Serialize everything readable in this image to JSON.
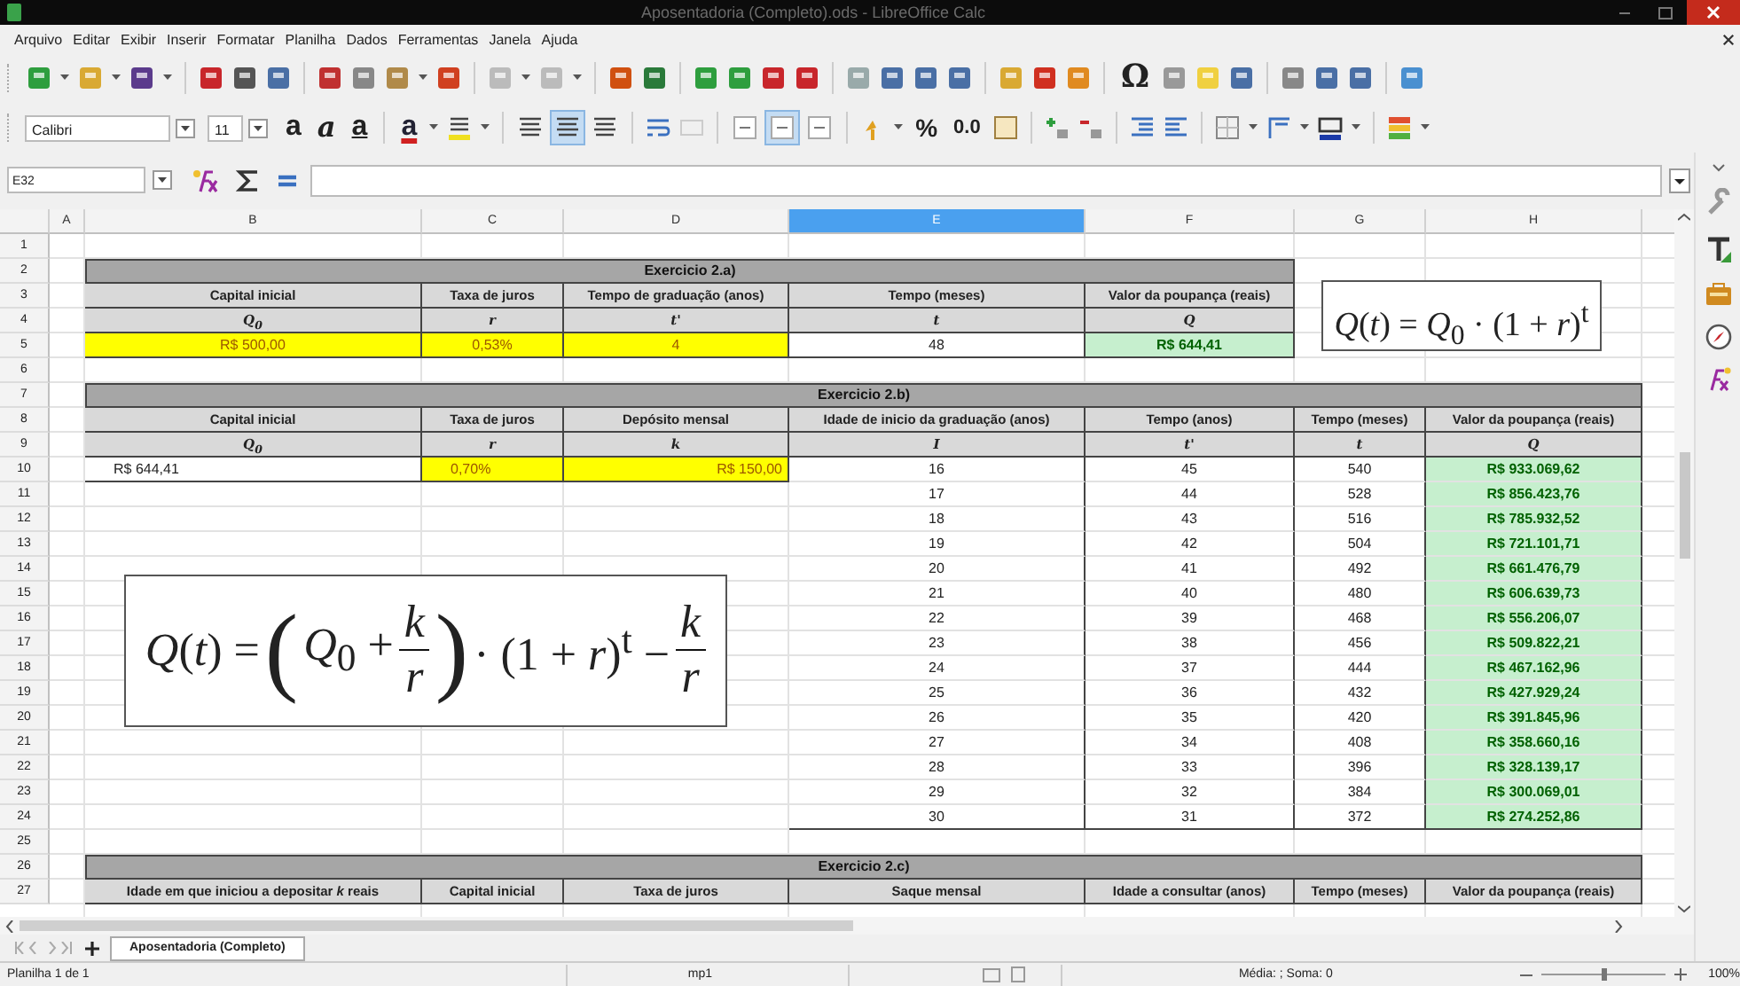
{
  "window": {
    "title": "Aposentadoria (Completo).ods - LibreOffice Calc"
  },
  "menu": [
    "Arquivo",
    "Editar",
    "Exibir",
    "Inserir",
    "Formatar",
    "Planilha",
    "Dados",
    "Ferramentas",
    "Janela",
    "Ajuda"
  ],
  "toolbar": {
    "special_character": "Ω"
  },
  "format_toolbar": {
    "font_name": "Calibri",
    "font_size": "11",
    "bold": "a",
    "italic": "a",
    "underline": "a",
    "font_color": "a",
    "percent": "%",
    "number": "0.0",
    "horizontal_align": [
      {
        "selected": false
      },
      {
        "selected": true
      },
      {
        "selected": false
      }
    ],
    "vertical_align": [
      {
        "selected": false
      },
      {
        "selected": true
      },
      {
        "selected": false
      }
    ]
  },
  "formula_bar": {
    "name_box": "E32"
  },
  "columns": [
    {
      "label": "A",
      "selected": false
    },
    {
      "label": "B",
      "selected": false
    },
    {
      "label": "C",
      "selected": false
    },
    {
      "label": "D",
      "selected": false
    },
    {
      "label": "E",
      "selected": true
    },
    {
      "label": "F",
      "selected": false
    },
    {
      "label": "G",
      "selected": false
    },
    {
      "label": "H",
      "selected": false
    }
  ],
  "row_numbers": [
    "1",
    "2",
    "3",
    "4",
    "5",
    "6",
    "7",
    "8",
    "9",
    "10",
    "11",
    "12",
    "13",
    "14",
    "15",
    "16",
    "17",
    "18",
    "19",
    "20",
    "21",
    "22",
    "23",
    "24",
    "25",
    "26",
    "27"
  ],
  "exercise_a": {
    "title": "Exercicio 2.a)",
    "headers": [
      "Capital inicial",
      "Taxa de juros",
      "Tempo de graduação (anos)",
      "Tempo (meses)",
      "Valor da poupança (reais)"
    ],
    "symbols": [
      "Q$_{0}$",
      "r",
      "t'",
      "t",
      "Q"
    ],
    "values": [
      {
        "text": "R$ 500,00",
        "kind": "input"
      },
      {
        "text": "0,53%",
        "kind": "input"
      },
      {
        "text": "4",
        "kind": "input"
      },
      {
        "text": "48",
        "kind": "plain"
      },
      {
        "text": "R$ 644,41",
        "kind": "result"
      }
    ]
  },
  "formula_a": "*Q*(*t*) = *Q*$_{0}$ · (1 + *r*)$^{t}$",
  "exercise_b": {
    "title": "Exercicio 2.b)",
    "headers": [
      "Capital inicial",
      "Taxa de juros",
      "Depósito mensal",
      "Idade de inicio da graduação (anos)",
      "Tempo (anos)",
      "Tempo (meses)",
      "Valor da poupança (reais)"
    ],
    "symbols": [
      "Q$_{0}$",
      "r",
      "k",
      "I",
      "t'",
      "t",
      "Q"
    ],
    "inputs": [
      {
        "text": "R$ 644,41",
        "kind": "plain"
      },
      {
        "text": "0,70%",
        "kind": "input"
      },
      {
        "text": "R$ 150,00",
        "kind": "input"
      }
    ],
    "rows": [
      {
        "age": "16",
        "years": "45",
        "months": "540",
        "value": "R$ 933.069,62"
      },
      {
        "age": "17",
        "years": "44",
        "months": "528",
        "value": "R$ 856.423,76"
      },
      {
        "age": "18",
        "years": "43",
        "months": "516",
        "value": "R$ 785.932,52"
      },
      {
        "age": "19",
        "years": "42",
        "months": "504",
        "value": "R$ 721.101,71"
      },
      {
        "age": "20",
        "years": "41",
        "months": "492",
        "value": "R$ 661.476,79"
      },
      {
        "age": "21",
        "years": "40",
        "months": "480",
        "value": "R$ 606.639,73"
      },
      {
        "age": "22",
        "years": "39",
        "months": "468",
        "value": "R$ 556.206,07"
      },
      {
        "age": "23",
        "years": "38",
        "months": "456",
        "value": "R$ 509.822,21"
      },
      {
        "age": "24",
        "years": "37",
        "months": "444",
        "value": "R$ 467.162,96"
      },
      {
        "age": "25",
        "years": "36",
        "months": "432",
        "value": "R$ 427.929,24"
      },
      {
        "age": "26",
        "years": "35",
        "months": "420",
        "value": "R$ 391.845,96"
      },
      {
        "age": "27",
        "years": "34",
        "months": "408",
        "value": "R$ 358.660,16"
      },
      {
        "age": "28",
        "years": "33",
        "months": "396",
        "value": "R$ 328.139,17"
      },
      {
        "age": "29",
        "years": "32",
        "months": "384",
        "value": "R$ 300.069,01"
      },
      {
        "age": "30",
        "years": "31",
        "months": "372",
        "value": "R$ 274.252,86"
      }
    ]
  },
  "formula_b": [
    {
      "kind": "text",
      "text": "*Q*(*t*) ="
    },
    {
      "kind": "paren",
      "text": "("
    },
    {
      "kind": "text",
      "text": "*Q*$_{0}$ +"
    },
    {
      "kind": "frac",
      "num": "k",
      "den": "r"
    },
    {
      "kind": "paren",
      "text": ")"
    },
    {
      "kind": "text",
      "text": "· (1 + *r*)$^{t}$ −"
    },
    {
      "kind": "frac",
      "num": "k",
      "den": "r"
    }
  ],
  "exercise_c": {
    "title": "Exercicio 2.c)",
    "headers": [
      "Idade em que iniciou a depositar *k* reais",
      "Capital inicial",
      "Taxa de juros",
      "Saque mensal",
      "Idade a consultar (anos)",
      "Tempo (meses)",
      "Valor da poupança (reais)"
    ]
  },
  "sheet_tabs": [
    {
      "label": "Aposentadoria (Completo)",
      "selected": true
    }
  ],
  "status_bar": {
    "sheet": "Planilha 1 de 1",
    "page_style": "mp1",
    "summary": "Média: ; Soma: 0",
    "zoom": "100%",
    "zoom_slider": {
      "level": 0.5
    }
  }
}
